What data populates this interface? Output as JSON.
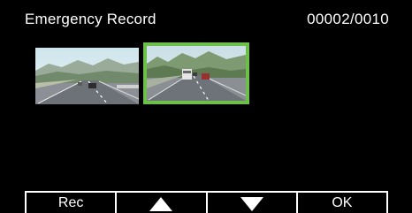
{
  "header": {
    "title": "Emergency Record",
    "counter": "00002/0010"
  },
  "thumbnails": [
    {
      "selected": false,
      "icon": "highway-video-thumbnail"
    },
    {
      "selected": true,
      "icon": "highway-video-thumbnail"
    }
  ],
  "softkeys": {
    "rec_label": "Rec",
    "up_icon": "up-triangle-icon",
    "down_icon": "down-triangle-icon",
    "ok_label": "OK"
  },
  "colors": {
    "background": "#000000",
    "selection": "#6cc04a",
    "text": "#ffffff"
  }
}
